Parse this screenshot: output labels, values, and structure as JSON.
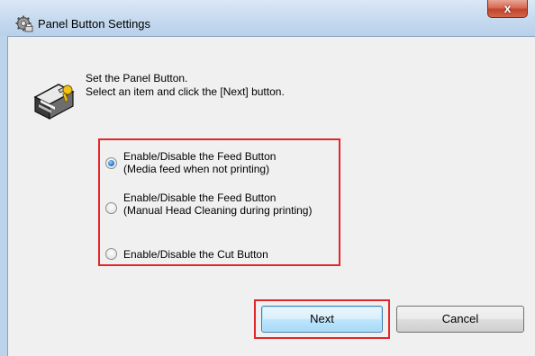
{
  "window": {
    "title": "Panel Button Settings",
    "close_label": "x",
    "title_icon": "gear-printer-icon"
  },
  "instructions": {
    "icon": "printer-wizard-icon",
    "line1": "Set the Panel Button.",
    "line2": "Select an item and click the [Next] button."
  },
  "options": [
    {
      "line1": "Enable/Disable the Feed Button",
      "line2": "(Media feed when not printing)",
      "selected": true
    },
    {
      "line1": "Enable/Disable the Feed Button",
      "line2": "(Manual Head Cleaning during printing)",
      "selected": false
    },
    {
      "line1": "Enable/Disable the Cut Button",
      "line2": "",
      "selected": false
    }
  ],
  "buttons": {
    "next": "Next",
    "cancel": "Cancel"
  },
  "colors": {
    "highlight": "#e3262b",
    "selected_radio": "#2b7fd2"
  }
}
